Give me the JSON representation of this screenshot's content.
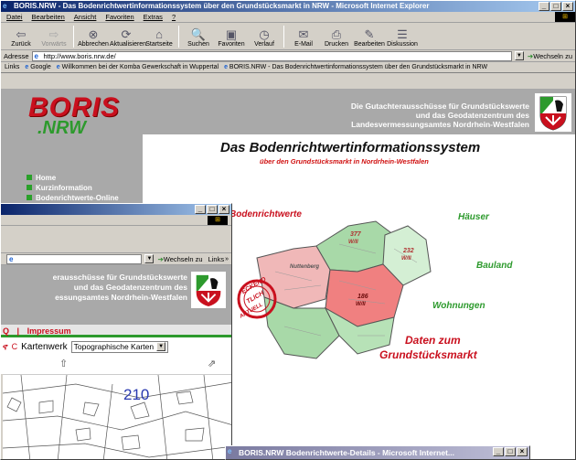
{
  "browser": {
    "title": "BORIS.NRW - Das Bodenrichtwertinformationssystem über den Grundstücksmarkt in NRW - Microsoft Internet Explorer",
    "menu": [
      "Datei",
      "Bearbeiten",
      "Ansicht",
      "Favoriten",
      "Extras",
      "?"
    ],
    "toolbar": [
      {
        "label": "Zurück",
        "icon": "back-arrow-icon",
        "glyph": "⇦",
        "enabled": true
      },
      {
        "label": "Vorwärts",
        "icon": "forward-arrow-icon",
        "glyph": "⇨",
        "enabled": false
      },
      {
        "label": "Abbrechen",
        "icon": "stop-icon",
        "glyph": "⊗",
        "enabled": true
      },
      {
        "label": "Aktualisieren",
        "icon": "refresh-icon",
        "glyph": "⟳",
        "enabled": true
      },
      {
        "label": "Startseite",
        "icon": "home-icon",
        "glyph": "⌂",
        "enabled": true
      },
      {
        "label": "Suchen",
        "icon": "search-icon",
        "glyph": "🔍",
        "enabled": true
      },
      {
        "label": "Favoriten",
        "icon": "favorites-icon",
        "glyph": "▣",
        "enabled": true
      },
      {
        "label": "Verlauf",
        "icon": "history-icon",
        "glyph": "◷",
        "enabled": true
      },
      {
        "label": "E-Mail",
        "icon": "mail-icon",
        "glyph": "✉",
        "enabled": true
      },
      {
        "label": "Drucken",
        "icon": "print-icon",
        "glyph": "⎙",
        "enabled": true
      },
      {
        "label": "Bearbeiten",
        "icon": "edit-icon",
        "glyph": "✎",
        "enabled": true
      },
      {
        "label": "Diskussion",
        "icon": "discussion-icon",
        "glyph": "☰",
        "enabled": true
      }
    ],
    "address_label": "Adresse",
    "address_value": "http://www.boris.nrw.de/",
    "go_label": "Wechseln zu",
    "links_label": "Links",
    "links": [
      "Google",
      "Willkommen bei der Komba Gewerkschaft in Wuppertal",
      "BORIS.NRW - Das Bodenrichtwertinformationssystem über den Grundstücksmarkt in NRW"
    ]
  },
  "site": {
    "logo_top": "BORIS",
    "logo_bottom": ".NRW",
    "header_lines": [
      "Die Gutachterausschüsse für Grundstückswerte",
      "und das Geodatenzentrum des",
      "Landesvermessungsamtes Nordrhein-Westfalen"
    ],
    "nav": [
      "Home",
      "Kurzinformation",
      "Bodenrichtwerte-Online"
    ],
    "title": "Das Bodenrichtwertinformationssystem",
    "subtitle": "über den Grundstücksmarkt in Nordrhein-Westfalen",
    "map_labels": {
      "bodenrichtwerte": "Bodenrichtwerte",
      "haeuser": "Häuser",
      "bauland": "Bauland",
      "wohnungen": "Wohnungen",
      "daten": "Daten zum",
      "grundstuecksmarkt": "Grundstücksmarkt",
      "stamp_top": "ECKEND",
      "stamp_mid": "TLICH",
      "stamp_bot": "AKTUELL",
      "city": "Nuttenberg",
      "values": [
        "377",
        "W/II",
        "232",
        "W/II",
        "186",
        "W/II"
      ]
    }
  },
  "window2": {
    "go_label": "Wechseln zu",
    "links_label": "Links",
    "header_lines": [
      "erausschüsse für Grundstückswerte",
      "und das Geodatenzentrum des",
      "essungsamtes Nordrhein-Westfalen"
    ],
    "nav_prefix": "Q",
    "nav_item": "Impressum",
    "kartenwerk_label": "Kartenwerk",
    "kartenwerk_value": "Topographische Karten",
    "map_value": "210"
  },
  "window3": {
    "title": "BORIS.NRW Bodenrichtwerte-Details - Microsoft Internet..."
  },
  "colors": {
    "titlebar": "#0a246a",
    "header_gray": "#a9a9a9",
    "brand_red": "#c9101e",
    "brand_green": "#2d9a2d"
  }
}
